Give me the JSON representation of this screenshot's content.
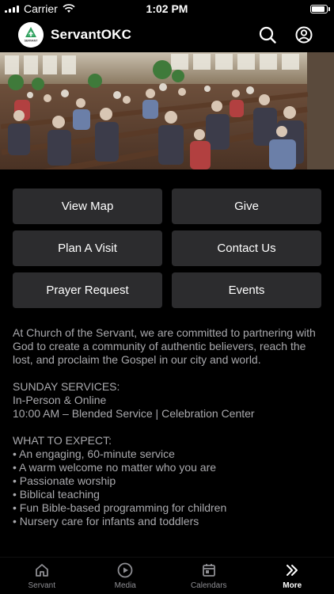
{
  "status_bar": {
    "carrier": "Carrier",
    "time": "1:02 PM",
    "battery_level": 0.95
  },
  "header": {
    "logo_text": "SERVANT",
    "title": "ServantOKC",
    "search_icon": "search-icon",
    "profile_icon": "user-circle-icon"
  },
  "buttons": [
    {
      "label": "View Map"
    },
    {
      "label": "Give"
    },
    {
      "label": "Plan A Visit"
    },
    {
      "label": "Contact Us"
    },
    {
      "label": "Prayer Request"
    },
    {
      "label": "Events"
    }
  ],
  "description": {
    "intro": "At Church of the Servant, we are committed to partnering with God to create a community of authentic believers, reach the lost, and proclaim the Gospel in our city and world.",
    "services_heading": "SUNDAY SERVICES:",
    "services_line1": "In-Person & Online",
    "services_line2": "10:00 AM – Blended Service | Celebration Center",
    "expect_heading": "WHAT TO EXPECT:",
    "expect_items": [
      "• An engaging, 60-minute service",
      "• A warm welcome no matter who you are",
      "• Passionate worship",
      "• Biblical teaching",
      "• Fun Bible-based programming for children",
      "• Nursery care for infants and toddlers"
    ]
  },
  "tabs": [
    {
      "label": "Servant",
      "icon": "home-icon",
      "active": false
    },
    {
      "label": "Media",
      "icon": "play-circle-icon",
      "active": false
    },
    {
      "label": "Calendars",
      "icon": "calendar-icon",
      "active": false
    },
    {
      "label": "More",
      "icon": "chevron-double-right-icon",
      "active": true
    }
  ],
  "colors": {
    "background": "#000000",
    "button_bg": "#2c2c2e",
    "body_text": "#a9a9ad",
    "tab_inactive": "#8e8e93",
    "logo_green": "#2e9e5b"
  }
}
